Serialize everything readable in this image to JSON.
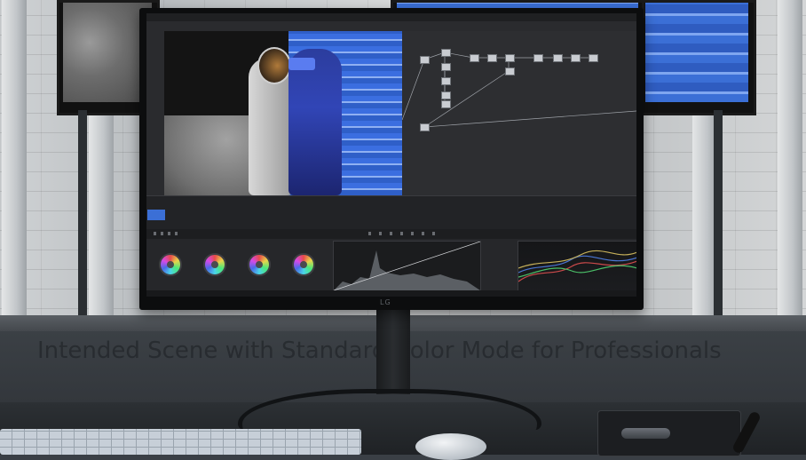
{
  "overlay_text": "Intended Scene with Standard Color Mode for Professionals",
  "monitor": {
    "brand_logo": "LG"
  },
  "app": {
    "menu_items": [
      "",
      "",
      "",
      "",
      "",
      "",
      "",
      ""
    ]
  },
  "colors": {
    "stripe_blue": "#3b6fd6",
    "wall": "#cfd2d4",
    "desk": "#2c3034",
    "bezel": "#0c0d0e"
  },
  "icons": [
    "lg-logo"
  ]
}
